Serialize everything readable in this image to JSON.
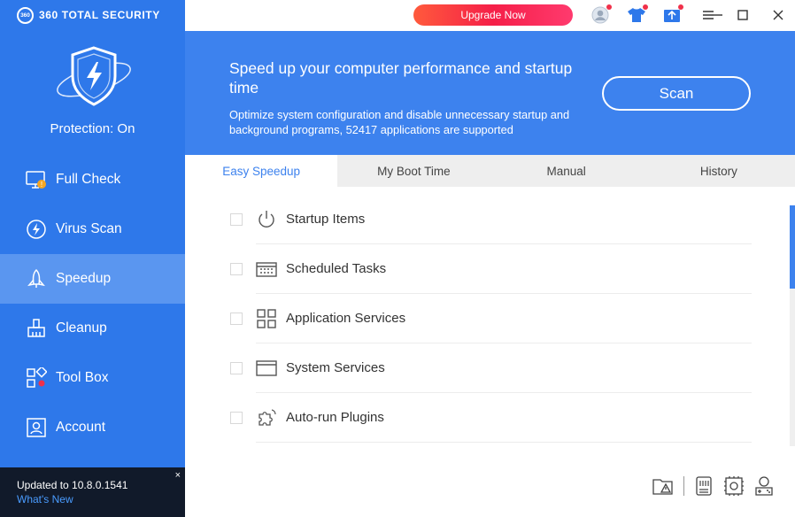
{
  "brand": {
    "logo_text": "360",
    "name": "360 TOTAL SECURITY"
  },
  "sidebar": {
    "protection_status": "Protection: On",
    "items": [
      {
        "label": "Full Check",
        "icon": "monitor-alert-icon"
      },
      {
        "label": "Virus Scan",
        "icon": "bolt-circle-icon"
      },
      {
        "label": "Speedup",
        "icon": "rocket-icon"
      },
      {
        "label": "Cleanup",
        "icon": "broom-icon"
      },
      {
        "label": "Tool Box",
        "icon": "grid-tools-icon"
      },
      {
        "label": "Account",
        "icon": "user-icon"
      }
    ],
    "active": "Speedup"
  },
  "update": {
    "text": "Updated to 10.8.0.1541",
    "link": "What's New",
    "close": "×"
  },
  "topbar": {
    "upgrade_label": "Upgrade Now"
  },
  "banner": {
    "title": "Speed up your computer performance and startup time",
    "description": "Optimize system configuration and disable unnecessary startup and background programs, 52417 applications are supported",
    "scan_label": "Scan"
  },
  "tabs": [
    {
      "label": "Easy Speedup"
    },
    {
      "label": "My Boot Time"
    },
    {
      "label": "Manual"
    },
    {
      "label": "History"
    }
  ],
  "active_tab": "Easy Speedup",
  "items": [
    {
      "label": "Startup Items",
      "icon": "power-icon"
    },
    {
      "label": "Scheduled Tasks",
      "icon": "keyboard-icon"
    },
    {
      "label": "Application Services",
      "icon": "apps-grid-icon"
    },
    {
      "label": "System Services",
      "icon": "window-icon"
    },
    {
      "label": "Auto-run Plugins",
      "icon": "puzzle-icon"
    }
  ],
  "colors": {
    "sidebar": "#2e78ea",
    "banner": "#3d82ee",
    "accent": "#3d82ee",
    "upgrade": "#f51f48"
  }
}
